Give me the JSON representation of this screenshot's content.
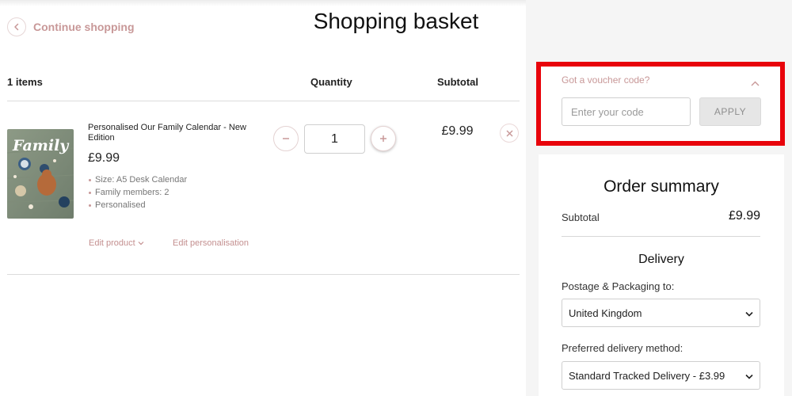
{
  "header": {
    "continue_label": "Continue shopping",
    "page_title": "Shopping basket"
  },
  "basket": {
    "columns": {
      "items": "1 items",
      "quantity": "Quantity",
      "subtotal": "Subtotal"
    },
    "item": {
      "name": "Personalised Our Family Calendar - New Edition",
      "price": "£9.99",
      "attributes": [
        "Size: A5 Desk Calendar",
        "Family members: 2",
        "Personalised"
      ],
      "edit_product_label": "Edit product",
      "edit_personalisation_label": "Edit personalisation",
      "quantity": "1",
      "line_subtotal": "£9.99",
      "thumbnail_text": "Family"
    }
  },
  "voucher": {
    "heading": "Got a voucher code?",
    "placeholder": "Enter your code",
    "apply_label": "APPLY",
    "highlight_color": "#e8030b"
  },
  "order_summary": {
    "title": "Order summary",
    "subtotal_label": "Subtotal",
    "subtotal_value": "£9.99",
    "delivery_title": "Delivery",
    "postage_label": "Postage & Packaging to:",
    "postage_value": "United Kingdom",
    "method_label": "Preferred delivery method:",
    "method_value": "Standard Tracked Delivery - £3.99"
  },
  "colors": {
    "accent": "#c89898",
    "text": "#222222",
    "panel_bg": "#f5f5f5"
  }
}
